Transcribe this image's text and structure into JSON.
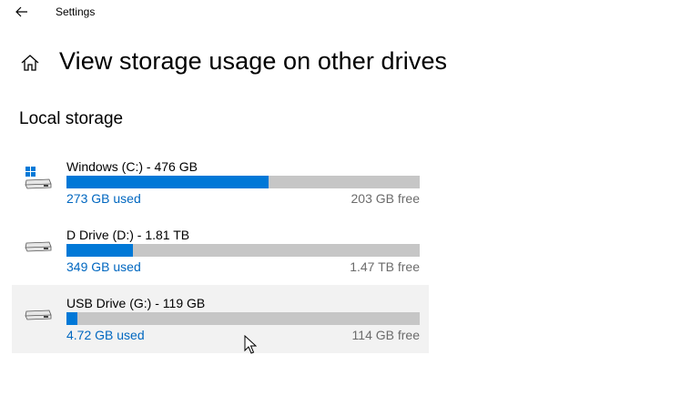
{
  "window": {
    "title": "Settings",
    "back_icon": "arrow-left-icon"
  },
  "page": {
    "home_icon": "home-icon",
    "title": "View storage usage on other drives"
  },
  "section": {
    "heading": "Local storage"
  },
  "drives": [
    {
      "name": "Windows (C:) - 476 GB",
      "used": "273 GB used",
      "free": "203 GB free",
      "used_fraction": 0.573,
      "icon": "windows-drive-icon",
      "hovered": false
    },
    {
      "name": "D Drive (D:) - 1.81 TB",
      "used": "349 GB used",
      "free": "1.47 TB free",
      "used_fraction": 0.188,
      "icon": "drive-icon",
      "hovered": false
    },
    {
      "name": "USB Drive (G:) - 119 GB",
      "used": "4.72 GB used",
      "free": "114 GB free",
      "used_fraction": 0.03,
      "icon": "drive-icon",
      "hovered": true
    }
  ],
  "colors": {
    "accent": "#0078d7",
    "link": "#0067c0",
    "bar_background": "#c6c6c6",
    "hover_background": "#f2f2f2"
  }
}
